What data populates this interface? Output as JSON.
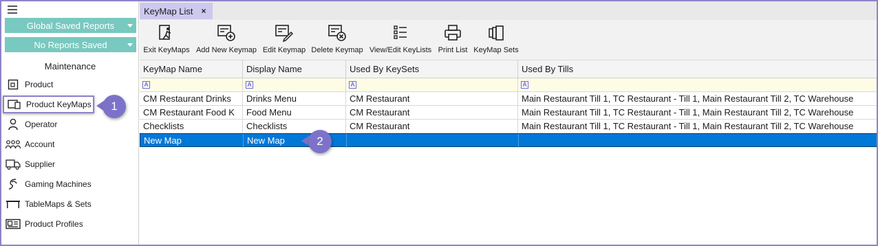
{
  "sidebar": {
    "saved_reports": "Global Saved Reports",
    "no_reports": "No Reports Saved",
    "heading": "Maintenance",
    "items": [
      {
        "label": "Product",
        "icon": "product-icon"
      },
      {
        "label": "Product KeyMaps",
        "icon": "keymap-icon"
      },
      {
        "label": "Operator",
        "icon": "operator-icon"
      },
      {
        "label": "Account",
        "icon": "account-icon"
      },
      {
        "label": "Supplier",
        "icon": "supplier-icon"
      },
      {
        "label": "Gaming Machines",
        "icon": "gaming-machines-icon"
      },
      {
        "label": "TableMaps & Sets",
        "icon": "table-icon"
      },
      {
        "label": "Product Profiles",
        "icon": "profile-icon"
      }
    ]
  },
  "callouts": [
    "1",
    "2"
  ],
  "tab": {
    "label": "KeyMap List",
    "close": "×"
  },
  "toolbar": [
    {
      "label": "Exit KeyMaps",
      "icon": "exit-icon"
    },
    {
      "label": "Add New Keymap",
      "icon": "add-keymap-icon"
    },
    {
      "label": "Edit Keymap",
      "icon": "edit-keymap-icon"
    },
    {
      "label": "Delete Keymap",
      "icon": "delete-keymap-icon"
    },
    {
      "label": "View/Edit KeyLists",
      "icon": "keylists-icon"
    },
    {
      "label": "Print List",
      "icon": "print-icon"
    },
    {
      "label": "KeyMap Sets",
      "icon": "keymap-sets-icon"
    }
  ],
  "grid": {
    "columns": [
      "KeyMap Name",
      "Display Name",
      "Used By KeySets",
      "Used By Tills"
    ],
    "filter_glyph": "A",
    "rows": [
      [
        "CM Restaurant Drinks",
        "Drinks Menu",
        "CM Restaurant",
        "Main Restaurant Till 1, TC Restaurant - Till 1, Main Restaurant Till 2, TC Warehouse"
      ],
      [
        "CM Restaurant Food K",
        "Food Menu",
        "CM Restaurant",
        "Main Restaurant Till 1, TC Restaurant - Till 1, Main Restaurant Till 2, TC Warehouse"
      ],
      [
        "Checklists",
        "Checklists",
        "CM Restaurant",
        "Main Restaurant Till 1, TC Restaurant - Till 1, Main Restaurant Till 2, TC Warehouse"
      ],
      [
        "New Map",
        "New Map",
        "",
        ""
      ]
    ],
    "selected_row": 3
  },
  "colors": {
    "accent": "#7d72c9",
    "teal": "#78c9bf",
    "selection": "#0078d7",
    "tab": "#cdc8ee"
  }
}
